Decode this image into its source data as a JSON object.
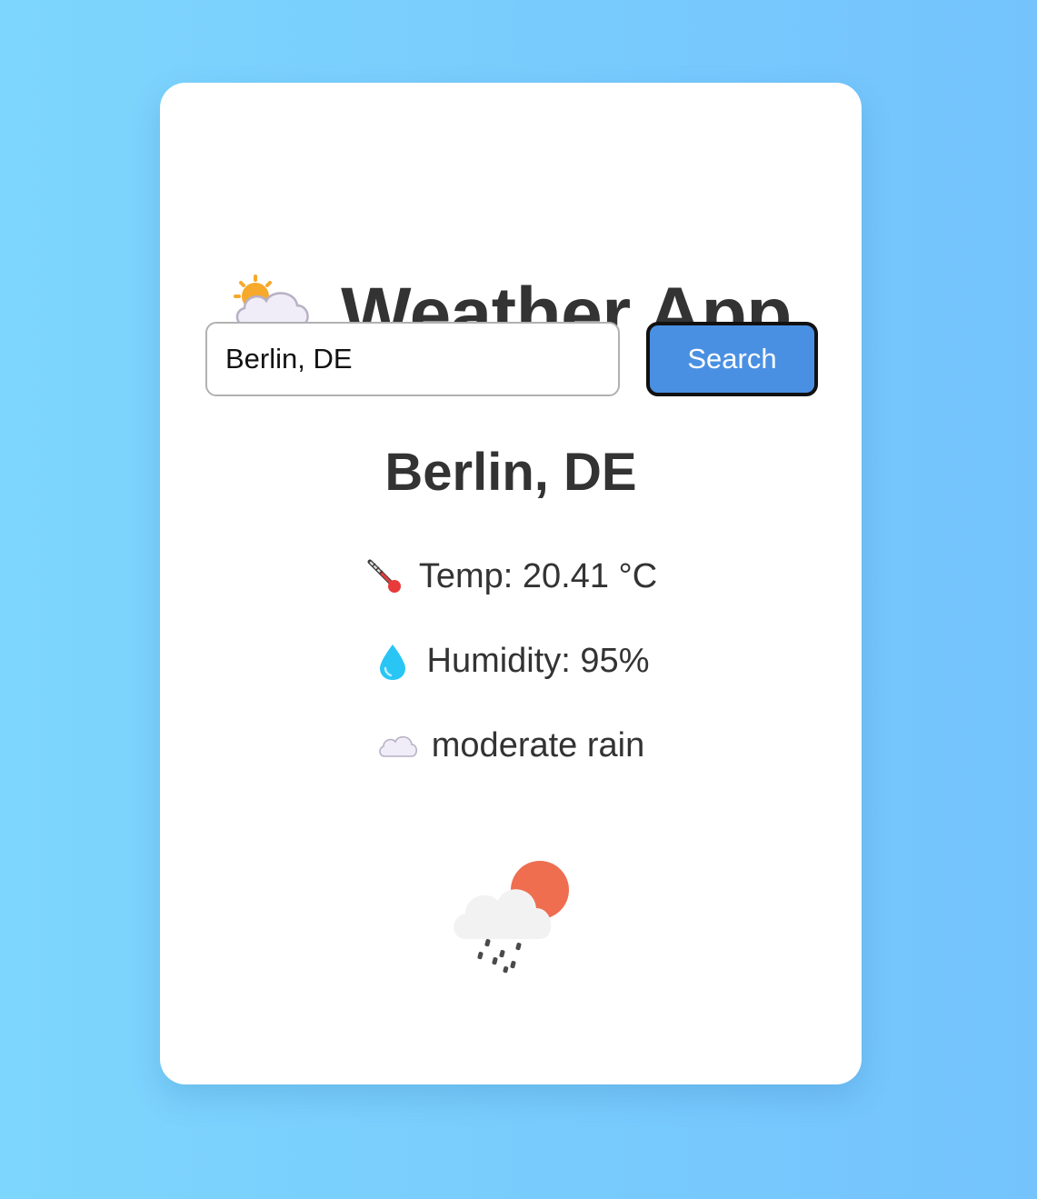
{
  "app": {
    "title": "Weather App",
    "title_icon": "cloud-rain-sun-icon"
  },
  "search": {
    "value": "Berlin, DE",
    "button_label": "Search"
  },
  "weather": {
    "city": "Berlin, DE",
    "temp_text": "Temp: 20.41 °C",
    "temp_icon": "thermometer-icon",
    "humidity_text": "Humidity: 95%",
    "humidity_icon": "droplet-icon",
    "description": "moderate rain",
    "description_icon": "cloud-icon",
    "condition_image": "rain-cloud-sun-icon"
  },
  "colors": {
    "accent": "#4a90e2",
    "text": "#333333",
    "background_start": "#7dd6fd",
    "background_end": "#74c3fd",
    "sun": "#ee6e4f",
    "rain": "#4a62e8"
  }
}
